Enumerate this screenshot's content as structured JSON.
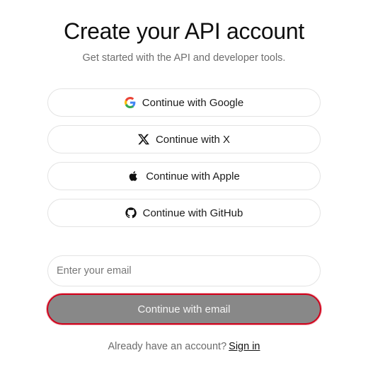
{
  "header": {
    "title": "Create your API account",
    "subtitle": "Get started with the API and developer tools."
  },
  "providers": [
    {
      "label": "Continue with Google",
      "icon": "google-icon"
    },
    {
      "label": "Continue with X",
      "icon": "x-icon"
    },
    {
      "label": "Continue with Apple",
      "icon": "apple-icon"
    },
    {
      "label": "Continue with GitHub",
      "icon": "github-icon"
    }
  ],
  "email": {
    "placeholder": "Enter your email",
    "value": "",
    "submit_label": "Continue with email"
  },
  "footer": {
    "prompt": "Already have an account?",
    "link_label": "Sign in"
  },
  "colors": {
    "highlight_border": "#d0021b",
    "email_button_bg": "#888888",
    "google_blue": "#4285F4",
    "google_red": "#EA4335",
    "google_yellow": "#FBBC05",
    "google_green": "#34A853"
  }
}
